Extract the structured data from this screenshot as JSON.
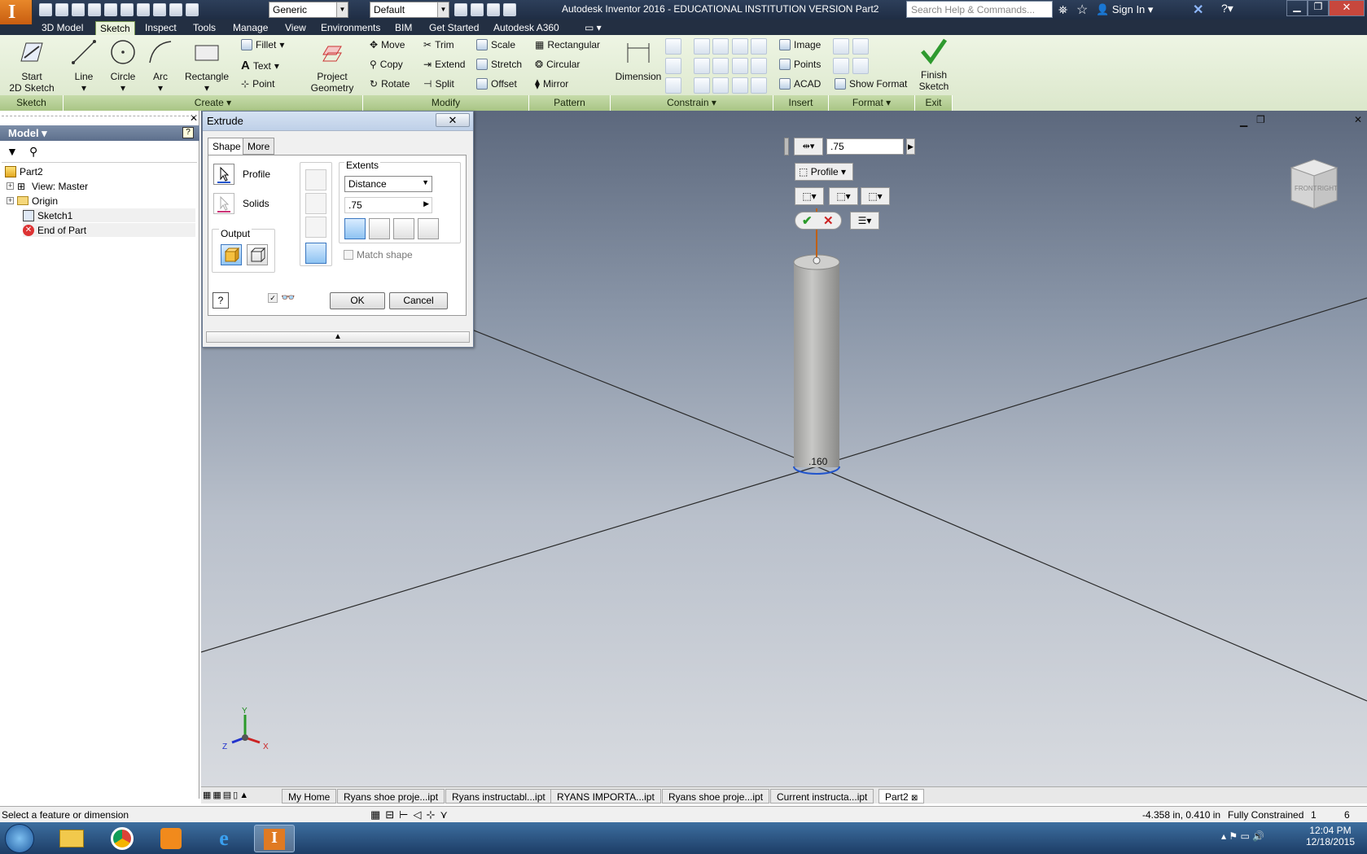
{
  "app": {
    "title": "Autodesk Inventor 2016 - EDUCATIONAL INSTITUTION VERSION   Part2",
    "logo_letter": "I",
    "search_placeholder": "Search Help & Commands...",
    "sign_in": "Sign In",
    "material_combo": "Generic",
    "appearance_combo": "Default"
  },
  "ribbon_tabs": [
    "3D Model",
    "Sketch",
    "Inspect",
    "Tools",
    "Manage",
    "View",
    "Environments",
    "BIM",
    "Get Started",
    "Autodesk A360"
  ],
  "ribbon": {
    "start_sketch": "Start\n2D Sketch",
    "start_sketch_l1": "Start",
    "start_sketch_l2": "2D Sketch",
    "line": "Line",
    "circle": "Circle",
    "arc": "Arc",
    "rectangle": "Rectangle",
    "fillet": "Fillet",
    "text": "Text",
    "point": "Point",
    "project_geometry_l1": "Project",
    "project_geometry_l2": "Geometry",
    "move": "Move",
    "copy": "Copy",
    "rotate": "Rotate",
    "trim": "Trim",
    "extend": "Extend",
    "split": "Split",
    "scale": "Scale",
    "stretch": "Stretch",
    "offset": "Offset",
    "rectangular": "Rectangular",
    "circular": "Circular",
    "mirror": "Mirror",
    "dimension": "Dimension",
    "image": "Image",
    "points": "Points",
    "acad": "ACAD",
    "show_format": "Show Format",
    "finish_l1": "Finish",
    "finish_l2": "Sketch",
    "panels": {
      "sketch": "Sketch",
      "create": "Create",
      "modify": "Modify",
      "pattern": "Pattern",
      "constrain": "Constrain",
      "insert": "Insert",
      "format": "Format",
      "exit": "Exit"
    }
  },
  "browser": {
    "header": "Model",
    "items": [
      {
        "label": "Part2",
        "expander": ""
      },
      {
        "label": "View: Master",
        "expander": "+"
      },
      {
        "label": "Origin",
        "expander": "+"
      },
      {
        "label": "Sketch1",
        "expander": ""
      },
      {
        "label": "End of Part",
        "expander": ""
      }
    ]
  },
  "dialog": {
    "title": "Extrude",
    "close": "✕",
    "tab_shape": "Shape",
    "tab_more": "More",
    "profile": "Profile",
    "solids": "Solids",
    "output": "Output",
    "extents": "Extents",
    "extents_type": "Distance",
    "distance": ".75",
    "match_shape": "Match shape",
    "ok": "OK",
    "cancel": "Cancel"
  },
  "minitoolbar": {
    "distance": ".75",
    "profile": "Profile"
  },
  "viewport": {
    "dimension_label": ".160",
    "viewcube_front": "FRONT",
    "viewcube_right": "RIGHT",
    "axis_x": "X",
    "axis_y": "Y",
    "axis_z": "Z"
  },
  "doc_tabs": [
    "My Home",
    "Ryans shoe proje...ipt",
    "Ryans instructabl...ipt",
    "RYANS IMPORTA...ipt",
    "Ryans shoe proje...ipt",
    "Current instructa...ipt",
    "Part2"
  ],
  "status": {
    "message": "Select a feature or dimension",
    "coords": "-4.358 in, 0.410 in",
    "constraint": "Fully Constrained",
    "count1": "1",
    "count2": "6"
  },
  "taskbar": {
    "time": "12:04 PM",
    "date": "12/18/2015"
  },
  "colors": {
    "ribbon_bg": "#e4eed6",
    "panel_bar": "#b8d195",
    "title_bar": "#243450",
    "taskbar": "#2b5283"
  }
}
